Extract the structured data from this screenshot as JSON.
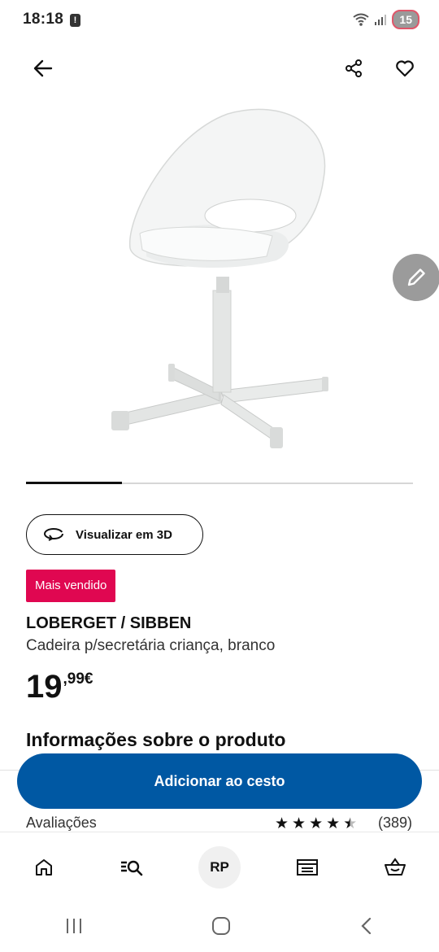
{
  "status_bar": {
    "time": "18:18",
    "battery": "15",
    "alert_icon": "alert-icon"
  },
  "header": {
    "back_icon": "arrow-left-icon",
    "share_icon": "share-icon",
    "favorite_icon": "heart-icon"
  },
  "product": {
    "image_icon": "chair-image",
    "badge": "Mais vendido",
    "name": "LOBERGET / SIBBEN",
    "description": "Cadeira p/secretária criança, branco",
    "price_integer": "19",
    "price_decimal": ",99€",
    "view_3d_label": "Visualizar em 3D"
  },
  "carousel": {
    "current": 1,
    "total": 4
  },
  "sections": {
    "info_heading": "Informações sobre o produto"
  },
  "cta": {
    "add_to_cart": "Adicionar ao cesto"
  },
  "reviews": {
    "label": "Avaliações",
    "rating": 4.5,
    "count": "(389)"
  },
  "bottom_nav": {
    "items": [
      {
        "name": "home",
        "icon": "home-icon"
      },
      {
        "name": "search",
        "icon": "search-list-icon"
      },
      {
        "name": "profile",
        "label": "RP"
      },
      {
        "name": "store",
        "icon": "store-icon"
      },
      {
        "name": "basket",
        "icon": "basket-icon"
      }
    ]
  },
  "colors": {
    "primary_button": "#0058a3",
    "badge": "#e00751",
    "fab": "#9b9b9b"
  }
}
